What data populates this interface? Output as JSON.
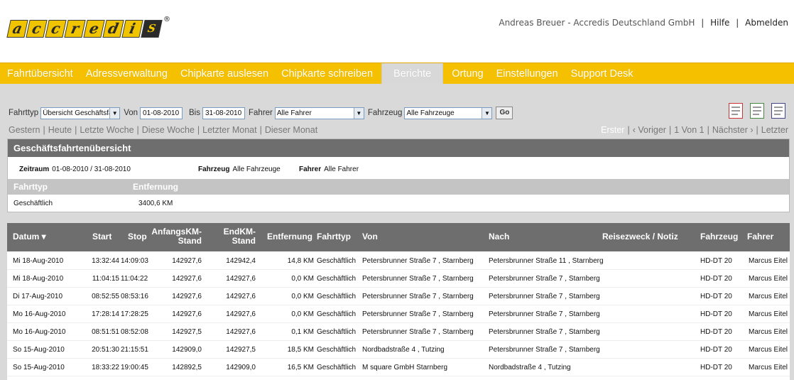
{
  "logo": {
    "letters": [
      "a",
      "c",
      "c",
      "r",
      "e",
      "d",
      "i",
      "S"
    ],
    "reg": "®"
  },
  "user_bar": {
    "user": "Andreas Breuer - Accredis Deutschland GmbH",
    "help": "Hilfe",
    "logout": "Abmelden"
  },
  "nav": {
    "items": [
      {
        "label": "Fahrtübersicht",
        "active": false
      },
      {
        "label": "Adressverwaltung",
        "active": false
      },
      {
        "label": "Chipkarte auslesen",
        "active": false
      },
      {
        "label": "Chipkarte schreiben",
        "active": false
      },
      {
        "label": "Berichte",
        "active": true
      },
      {
        "label": "Ortung",
        "active": false
      },
      {
        "label": "Einstellungen",
        "active": false
      },
      {
        "label": "Support Desk",
        "active": false
      }
    ]
  },
  "filters": {
    "fahrttyp_label": "Fahrttyp",
    "fahrttyp_value": "Übersicht Geschäftsfahrte",
    "von_label": "Von",
    "von_value": "01-08-2010",
    "bis_label": "Bis",
    "bis_value": "31-08-2010",
    "fahrer_label": "Fahrer",
    "fahrer_value": "Alle Fahrer",
    "fahrzeug_label": "Fahrzeug",
    "fahrzeug_value": "Alle Fahrzeuge",
    "go_label": "Go"
  },
  "export_icons": [
    "pdf-export-icon",
    "excel-export-icon",
    "word-export-icon"
  ],
  "quick_filters": [
    "Gestern",
    "Heute",
    "Letzte Woche",
    "Diese Woche",
    "Letzter Monat",
    "Dieser Monat"
  ],
  "pager": {
    "first": "Erster",
    "prev": "‹ Voriger",
    "info": "1 Von 1",
    "next": "Nächster ›",
    "last": "Letzter"
  },
  "summary": {
    "title": "Geschäftsfahrtenübersicht",
    "zeitraum_label": "Zeitraum",
    "zeitraum_value": "01-08-2010 / 31-08-2010",
    "fahrzeug_label": "Fahrzeug",
    "fahrzeug_value": "Alle Fahrzeuge",
    "fahrer_label": "Fahrer",
    "fahrer_value": "Alle Fahrer",
    "col_fahrttyp": "Fahrttyp",
    "col_entfernung": "Entfernung",
    "row_fahrttyp": "Geschäftlich",
    "row_entfernung": "3400,6 KM"
  },
  "table": {
    "headers": {
      "datum": "Datum ▾",
      "start": "Start",
      "stop": "Stop",
      "anfangskm_1": "AnfangsKM-",
      "anfangskm_2": "Stand",
      "endkm_1": "EndKM-",
      "endkm_2": "Stand",
      "entfernung": "Entfernung",
      "fahrttyp": "Fahrttyp",
      "von": "Von",
      "nach": "Nach",
      "reisezweck": "Reisezweck / Notiz",
      "fahrzeug": "Fahrzeug",
      "fahrer": "Fahrer"
    },
    "rows": [
      {
        "datum": "Mi 18-Aug-2010",
        "start": "13:32:44",
        "stop": "14:09:03",
        "anfang": "142927,6",
        "end": "142942,4",
        "entf": "14,8 KM",
        "typ": "Geschäftlich",
        "von": "Petersbrunner Straße 7 , Starnberg",
        "nach": "Petersbrunner Straße 11 , Starnberg",
        "notiz": "",
        "fahrzeug": "HD-DT 20",
        "fahrer": "Marcus Eitel"
      },
      {
        "datum": "Mi 18-Aug-2010",
        "start": "11:04:15",
        "stop": "11:04:22",
        "anfang": "142927,6",
        "end": "142927,6",
        "entf": "0,0 KM",
        "typ": "Geschäftlich",
        "von": "Petersbrunner Straße 7 , Starnberg",
        "nach": "Petersbrunner Straße 7 , Starnberg",
        "notiz": "",
        "fahrzeug": "HD-DT 20",
        "fahrer": "Marcus Eitel"
      },
      {
        "datum": "Di 17-Aug-2010",
        "start": "08:52:55",
        "stop": "08:53:16",
        "anfang": "142927,6",
        "end": "142927,6",
        "entf": "0,0 KM",
        "typ": "Geschäftlich",
        "von": "Petersbrunner Straße 7 , Starnberg",
        "nach": "Petersbrunner Straße 7 , Starnberg",
        "notiz": "",
        "fahrzeug": "HD-DT 20",
        "fahrer": "Marcus Eitel"
      },
      {
        "datum": "Mo 16-Aug-2010",
        "start": "17:28:14",
        "stop": "17:28:25",
        "anfang": "142927,6",
        "end": "142927,6",
        "entf": "0,0 KM",
        "typ": "Geschäftlich",
        "von": "Petersbrunner Straße 7 , Starnberg",
        "nach": "Petersbrunner Straße 7 , Starnberg",
        "notiz": "",
        "fahrzeug": "HD-DT 20",
        "fahrer": "Marcus Eitel"
      },
      {
        "datum": "Mo 16-Aug-2010",
        "start": "08:51:51",
        "stop": "08:52:08",
        "anfang": "142927,5",
        "end": "142927,6",
        "entf": "0,1 KM",
        "typ": "Geschäftlich",
        "von": "Petersbrunner Straße 7 , Starnberg",
        "nach": "Petersbrunner Straße 7 , Starnberg",
        "notiz": "",
        "fahrzeug": "HD-DT 20",
        "fahrer": "Marcus Eitel"
      },
      {
        "datum": "So 15-Aug-2010",
        "start": "20:51:30",
        "stop": "21:15:51",
        "anfang": "142909,0",
        "end": "142927,5",
        "entf": "18,5 KM",
        "typ": "Geschäftlich",
        "von": "Nordbadstraße 4 , Tutzing",
        "nach": "Petersbrunner Straße 7 , Starnberg",
        "notiz": "",
        "fahrzeug": "HD-DT 20",
        "fahrer": "Marcus Eitel"
      },
      {
        "datum": "So 15-Aug-2010",
        "start": "18:33:22",
        "stop": "19:00:45",
        "anfang": "142892,5",
        "end": "142909,0",
        "entf": "16,5 KM",
        "typ": "Geschäftlich",
        "von": "M square GmbH Starnberg",
        "nach": "Nordbadstraße 4 , Tutzing",
        "notiz": "",
        "fahrzeug": "HD-DT 20",
        "fahrer": "Marcus Eitel"
      }
    ]
  }
}
